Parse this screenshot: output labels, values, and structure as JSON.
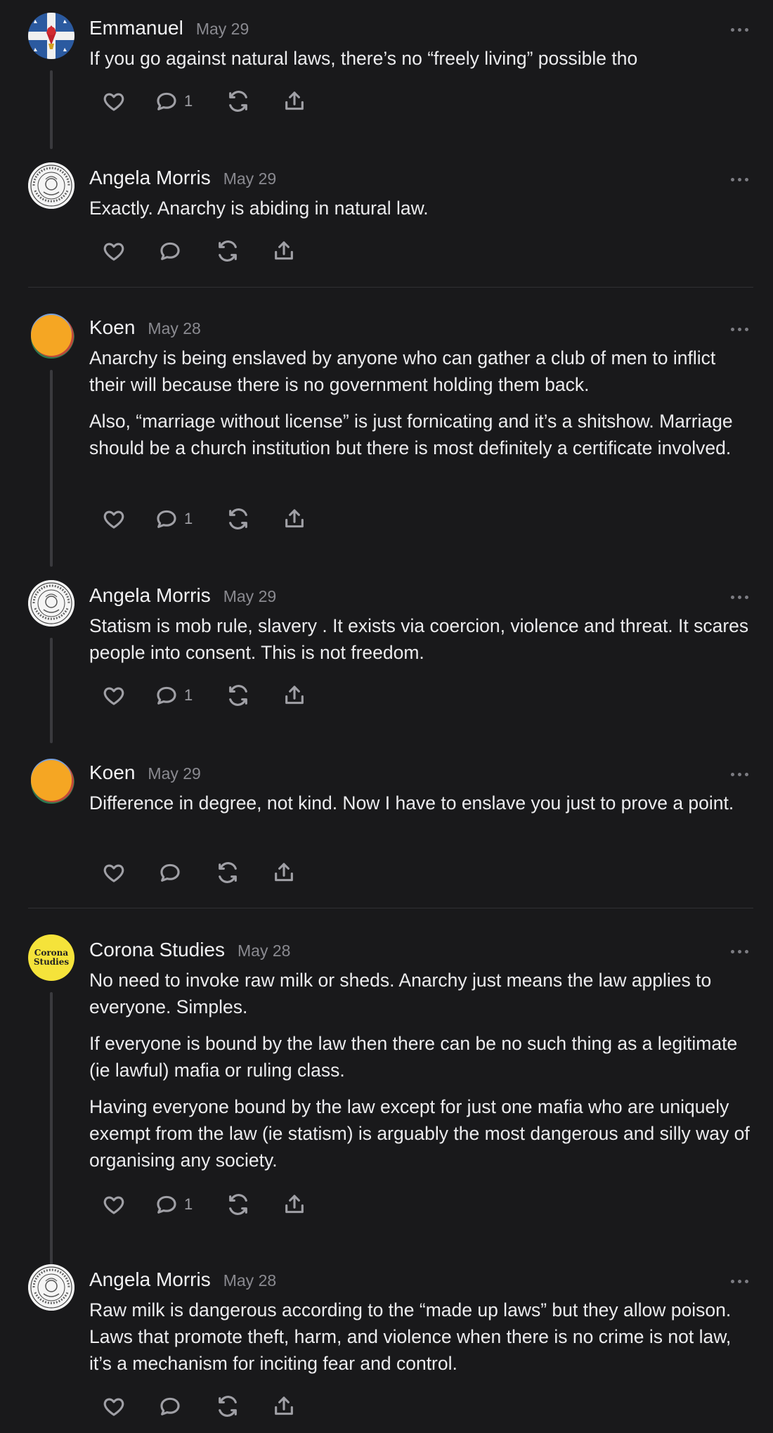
{
  "posts": [
    {
      "name": "Emmanuel",
      "date": "May 29",
      "avatar": "flag-cross-avatar",
      "paragraphs": [
        "If you go against natural laws, there’s no “freely living” possible tho"
      ],
      "reply_count": "1"
    },
    {
      "name": "Angela Morris",
      "date": "May 29",
      "avatar": "seal-avatar",
      "paragraphs": [
        "Exactly. Anarchy is abiding in natural law."
      ],
      "reply_count": ""
    },
    {
      "name": "Koen",
      "date": "May 28",
      "avatar": "orange-circle-avatar",
      "paragraphs": [
        "Anarchy is being enslaved by anyone who can gather a club of men to inflict their will because there is no government holding them back.",
        "Also, “marriage without license” is just fornicating and it’s a shitshow. Marriage should be a church institution but there is most definitely a certificate involved."
      ],
      "reply_count": "1"
    },
    {
      "name": "Angela Morris",
      "date": "May 29",
      "avatar": "seal-avatar",
      "paragraphs": [
        "Statism is mob rule, slavery . It exists via coercion, violence and threat. It scares people into consent. This is not freedom."
      ],
      "reply_count": "1"
    },
    {
      "name": "Koen",
      "date": "May 29",
      "avatar": "orange-circle-avatar",
      "paragraphs": [
        "Difference in degree, not kind. Now I have to enslave you just to prove a point."
      ],
      "reply_count": ""
    },
    {
      "name": "Corona Studies",
      "date": "May 28",
      "avatar": "corona-studies-avatar",
      "avatar_text": [
        "Corona",
        "Studies"
      ],
      "paragraphs": [
        "No need to invoke raw milk or sheds. Anarchy just means the law applies to everyone. Simples.",
        "If everyone is bound by the law then there can be no such thing as a legitimate (ie lawful) mafia or ruling class.",
        "Having everyone bound by the law except for just one mafia who are uniquely exempt from the law (ie statism) is arguably the most dangerous and silly way of organising any society."
      ],
      "reply_count": "1"
    },
    {
      "name": "Angela Morris",
      "date": "May 28",
      "avatar": "seal-avatar",
      "paragraphs": [
        "Raw milk is dangerous according to the “made up laws” but they allow poison. Laws that promote theft, harm, and violence when there is no crime is not law, it’s a mechanism for inciting fear and control."
      ],
      "reply_count": ""
    }
  ],
  "colors": {
    "background": "#19191b",
    "text": "#ececee",
    "muted": "#8a8a90",
    "corona_yellow": "#f5e33a",
    "koen_orange": "#f5a623"
  }
}
